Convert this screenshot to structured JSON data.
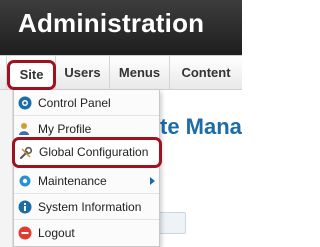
{
  "header": {
    "title": "Administration"
  },
  "menubar": {
    "items": [
      {
        "label": "Site"
      },
      {
        "label": "Users"
      },
      {
        "label": "Menus"
      },
      {
        "label": "Content"
      }
    ]
  },
  "background": {
    "title_fragment": "te Mana",
    "tab_fragment": "s"
  },
  "dropdown": {
    "items": [
      {
        "label": "Control Panel",
        "icon": "control-panel-icon"
      },
      {
        "label": "My Profile",
        "icon": "user-profile-icon"
      },
      {
        "label": "Global Configuration",
        "icon": "tools-icon"
      },
      {
        "label": "Maintenance",
        "icon": "gear-icon",
        "has_submenu": true
      },
      {
        "label": "System Information",
        "icon": "info-icon"
      },
      {
        "label": "Logout",
        "icon": "logout-icon"
      }
    ]
  },
  "colors": {
    "highlight": "#a01220",
    "accent": "#1b6ca8",
    "header_bg": "#2b2b2b"
  }
}
